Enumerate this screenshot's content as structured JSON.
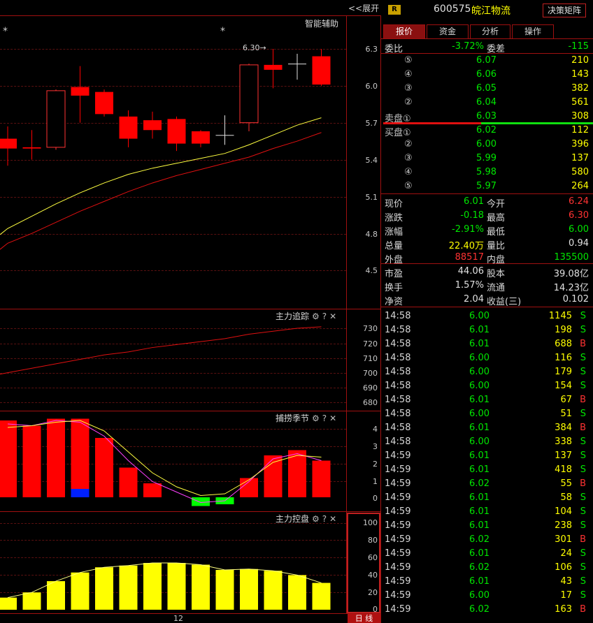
{
  "toolbar": {
    "expand_label": "<<展开",
    "r_badge": "R",
    "stock_code": "600575",
    "stock_name": "皖江物流",
    "decision_button": "决策矩阵"
  },
  "main_chart": {
    "title": "智能辅助",
    "stars": [
      "*",
      "*"
    ],
    "high_annotation": "6.30→",
    "y_labels": [
      "6.3",
      "6.0",
      "5.7",
      "5.4",
      "5.1",
      "4.8",
      "4.5"
    ]
  },
  "pane_zlzz": {
    "title": "主力追踪",
    "y_labels": [
      "730",
      "720",
      "710",
      "700",
      "690",
      "680"
    ]
  },
  "pane_blsj": {
    "title": "捕捞季节",
    "y_labels": [
      "4",
      "3",
      "2",
      "1",
      "0"
    ]
  },
  "pane_zlkp": {
    "title": "主力控盘",
    "y_labels": [
      "100",
      "80",
      "60",
      "40",
      "20",
      "0"
    ]
  },
  "x_axis": {
    "tick": "12"
  },
  "period_tab": "日 线",
  "icons": {
    "gear": "gear-icon",
    "help": "help-icon",
    "close": "close-icon"
  },
  "tabs": [
    "报价",
    "资金",
    "分析",
    "操作"
  ],
  "orderbook": {
    "wb_label": "委比",
    "wb_value": "-3.72%",
    "wc_label": "委差",
    "wc_value": "-115",
    "sell": [
      {
        "label": "⑤",
        "price": "6.07",
        "vol": "210"
      },
      {
        "label": "④",
        "price": "6.06",
        "vol": "143"
      },
      {
        "label": "③",
        "price": "6.05",
        "vol": "382"
      },
      {
        "label": "②",
        "price": "6.04",
        "vol": "561"
      },
      {
        "label": "卖盘①",
        "price": "6.03",
        "vol": "308"
      }
    ],
    "buy": [
      {
        "label": "买盘①",
        "price": "6.02",
        "vol": "112"
      },
      {
        "label": "②",
        "price": "6.00",
        "vol": "396"
      },
      {
        "label": "③",
        "price": "5.99",
        "vol": "137"
      },
      {
        "label": "④",
        "price": "5.98",
        "vol": "580"
      },
      {
        "label": "⑤",
        "price": "5.97",
        "vol": "264"
      }
    ]
  },
  "quote": [
    {
      "l1": "现价",
      "v1": "6.01",
      "c1": "green",
      "l2": "今开",
      "v2": "6.24",
      "c2": "red"
    },
    {
      "l1": "涨跌",
      "v1": "-0.18",
      "c1": "green",
      "l2": "最高",
      "v2": "6.30",
      "c2": "red"
    },
    {
      "l1": "涨幅",
      "v1": "-2.91%",
      "c1": "green",
      "l2": "最低",
      "v2": "6.00",
      "c2": "green"
    },
    {
      "l1": "总量",
      "v1": "22.40万",
      "c1": "yellow",
      "l2": "量比",
      "v2": "0.94",
      "c2": "white"
    },
    {
      "l1": "外盘",
      "v1": "88517",
      "c1": "red",
      "l2": "内盘",
      "v2": "135500",
      "c2": "green"
    },
    {
      "l1": "市盈",
      "v1": "44.06",
      "c1": "white",
      "l2": "股本",
      "v2": "39.08亿",
      "c2": "white"
    },
    {
      "l1": "换手",
      "v1": "1.57%",
      "c1": "white",
      "l2": "流通",
      "v2": "14.23亿",
      "c2": "white"
    },
    {
      "l1": "净资",
      "v1": "2.04",
      "c1": "white",
      "l2": "收益(三)",
      "v2": "0.102",
      "c2": "white"
    }
  ],
  "trades": [
    {
      "time": "14:58",
      "price": "6.00",
      "vol": "1145",
      "side": "S"
    },
    {
      "time": "14:58",
      "price": "6.01",
      "vol": "198",
      "side": "S"
    },
    {
      "time": "14:58",
      "price": "6.01",
      "vol": "688",
      "side": "B"
    },
    {
      "time": "14:58",
      "price": "6.00",
      "vol": "116",
      "side": "S"
    },
    {
      "time": "14:58",
      "price": "6.00",
      "vol": "179",
      "side": "S"
    },
    {
      "time": "14:58",
      "price": "6.00",
      "vol": "154",
      "side": "S"
    },
    {
      "time": "14:58",
      "price": "6.01",
      "vol": "67",
      "side": "B"
    },
    {
      "time": "14:58",
      "price": "6.00",
      "vol": "51",
      "side": "S"
    },
    {
      "time": "14:58",
      "price": "6.01",
      "vol": "384",
      "side": "B"
    },
    {
      "time": "14:58",
      "price": "6.00",
      "vol": "338",
      "side": "S"
    },
    {
      "time": "14:59",
      "price": "6.01",
      "vol": "137",
      "side": "S"
    },
    {
      "time": "14:59",
      "price": "6.01",
      "vol": "418",
      "side": "S"
    },
    {
      "time": "14:59",
      "price": "6.02",
      "vol": "55",
      "side": "B"
    },
    {
      "time": "14:59",
      "price": "6.01",
      "vol": "58",
      "side": "S"
    },
    {
      "time": "14:59",
      "price": "6.01",
      "vol": "104",
      "side": "S"
    },
    {
      "time": "14:59",
      "price": "6.01",
      "vol": "238",
      "side": "S"
    },
    {
      "time": "14:59",
      "price": "6.02",
      "vol": "301",
      "side": "B"
    },
    {
      "time": "14:59",
      "price": "6.01",
      "vol": "24",
      "side": "S"
    },
    {
      "time": "14:59",
      "price": "6.02",
      "vol": "106",
      "side": "S"
    },
    {
      "time": "14:59",
      "price": "6.01",
      "vol": "43",
      "side": "S"
    },
    {
      "time": "14:59",
      "price": "6.00",
      "vol": "17",
      "side": "S"
    },
    {
      "time": "14:59",
      "price": "6.02",
      "vol": "163",
      "side": "B"
    }
  ],
  "chart_data": [
    {
      "type": "candlestick",
      "ylim": [
        4.3,
        6.4
      ],
      "candles": [
        {
          "o": 5.57,
          "c": 5.49,
          "h": 5.67,
          "l": 5.35
        },
        {
          "o": 5.5,
          "c": 5.49,
          "h": 5.64,
          "l": 5.4
        },
        {
          "o": 5.5,
          "c": 5.96,
          "h": 5.97,
          "l": 5.48
        },
        {
          "o": 5.99,
          "c": 5.92,
          "h": 6.16,
          "l": 5.7
        },
        {
          "o": 5.95,
          "c": 5.77,
          "h": 5.97,
          "l": 5.75
        },
        {
          "o": 5.75,
          "c": 5.57,
          "h": 5.8,
          "l": 5.5
        },
        {
          "o": 5.72,
          "c": 5.64,
          "h": 5.79,
          "l": 5.57
        },
        {
          "o": 5.73,
          "c": 5.53,
          "h": 5.75,
          "l": 5.47
        },
        {
          "o": 5.63,
          "c": 5.53,
          "h": 5.64,
          "l": 5.5
        },
        {
          "o": 5.6,
          "c": 5.6,
          "h": 5.76,
          "l": 5.52
        },
        {
          "o": 5.7,
          "c": 6.17,
          "h": 6.18,
          "l": 5.63
        },
        {
          "o": 6.17,
          "c": 6.13,
          "h": 6.3,
          "l": 5.98
        },
        {
          "o": 6.18,
          "c": 6.18,
          "h": 6.26,
          "l": 6.05
        },
        {
          "o": 6.24,
          "c": 6.01,
          "h": 6.3,
          "l": 6.0
        }
      ],
      "ma_yellow": [
        4.84,
        4.94,
        5.04,
        5.13,
        5.21,
        5.28,
        5.33,
        5.37,
        5.41,
        5.45,
        5.52,
        5.6,
        5.68,
        5.74
      ],
      "ma_red": [
        4.72,
        4.8,
        4.89,
        4.98,
        5.06,
        5.14,
        5.21,
        5.27,
        5.32,
        5.37,
        5.42,
        5.49,
        5.55,
        5.62
      ]
    },
    {
      "type": "line",
      "title": "主力追踪",
      "ylim": [
        675,
        735
      ],
      "values": [
        700,
        703,
        706,
        709,
        712,
        714,
        717,
        719,
        721,
        723,
        726,
        728,
        730,
        731
      ]
    },
    {
      "type": "bar",
      "title": "捕捞季节",
      "ylim": [
        0,
        4.5
      ],
      "values": [
        4.4,
        4.1,
        4.5,
        4.5,
        3.4,
        1.7,
        0.8,
        0.0,
        -0.5,
        -0.4,
        1.1,
        2.4,
        2.7,
        2.1
      ],
      "blue_marker_index": 3,
      "line_yellow": [
        4.0,
        4.1,
        4.3,
        4.4,
        3.8,
        2.6,
        1.4,
        0.6,
        0.1,
        0.2,
        1.0,
        2.0,
        2.4,
        2.3
      ],
      "line_magenta": [
        4.2,
        4.1,
        4.4,
        4.3,
        3.5,
        2.1,
        0.9,
        0.3,
        -0.3,
        -0.2,
        0.9,
        2.2,
        2.5,
        2.1
      ]
    },
    {
      "type": "bar",
      "title": "主力控盘",
      "ylim": [
        0,
        105
      ],
      "values": [
        14,
        20,
        33,
        43,
        49,
        51,
        54,
        54,
        52,
        46,
        47,
        45,
        40,
        31
      ],
      "line": [
        14,
        20,
        33,
        43,
        49,
        51,
        54,
        54,
        52,
        46,
        47,
        45,
        40,
        31
      ]
    }
  ]
}
